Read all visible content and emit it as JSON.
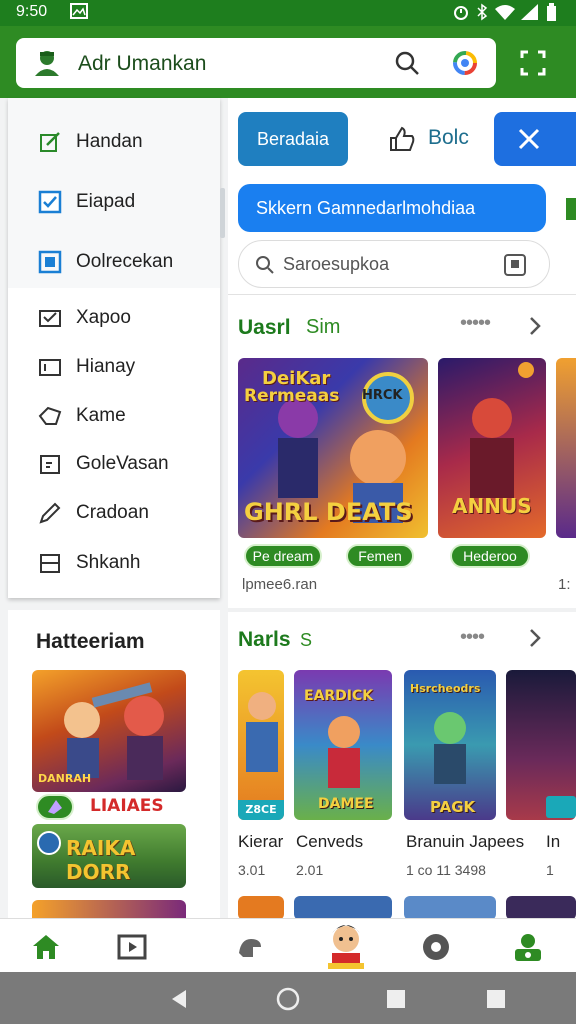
{
  "status_bar": {
    "time": "9:50"
  },
  "app_bar": {
    "title": "Adr Umankan"
  },
  "drawer": {
    "items": [
      {
        "label": "Handan",
        "icon": "edit-square-icon"
      },
      {
        "label": "Eiapad",
        "icon": "checkbox-icon"
      },
      {
        "label": "Oolrecekan",
        "icon": "square-icon"
      },
      {
        "label": "Xapoo",
        "icon": "mail-check-icon"
      },
      {
        "label": "Hianay",
        "icon": "window-icon"
      },
      {
        "label": "Kame",
        "icon": "tag-icon"
      },
      {
        "label": "GoleVasan",
        "icon": "calendar-icon"
      },
      {
        "label": "Cradoan",
        "icon": "pencil-icon"
      },
      {
        "label": "Shkanh",
        "icon": "minus-box-icon"
      }
    ]
  },
  "side_card": {
    "title": "Hatteeriam",
    "game1_caption": "LIAIAES",
    "game1_art": "DANRAH",
    "game2_art": "RAIKA DORR"
  },
  "main": {
    "chips": {
      "primary": "Beradaia",
      "secondary": "Bolc"
    },
    "promo_bar": "Skkern Gamnedarlmohdiaa",
    "search_placeholder": "Saroesupkoa",
    "section1": {
      "title": "Uasrl",
      "title_suffix": "Sim",
      "games": [
        {
          "art_title": "Rermeaas",
          "art_top": "DeiKar",
          "art_bottom": "GHRL DEATS",
          "art_badge": "HRCK",
          "tag": "Pe dream"
        },
        {
          "art_title": "",
          "art_top": "",
          "art_bottom": "",
          "art_badge": "",
          "tag": "Femen"
        },
        {
          "art_title": "",
          "art_top": "",
          "art_bottom": "ANNUS",
          "art_badge": "",
          "tag": "Hederoo"
        }
      ],
      "caption": "lpmee6.ran",
      "caption_right": "1:"
    },
    "section2": {
      "title": "Narls",
      "title_suffix": "S",
      "games": [
        {
          "name": "Kierar",
          "sub": "3.01",
          "art": "",
          "badge": "Z8CE"
        },
        {
          "name": "Cenveds",
          "sub": "2.01",
          "art": "DAMEE",
          "art_top": "EARDICK",
          "badge": ""
        },
        {
          "name": "Branuin Japees",
          "sub": "1 co 11 3498",
          "art": "PAGK",
          "art_top": "Hsrcheodrs",
          "badge": ""
        },
        {
          "name": "In",
          "sub": "1",
          "art": "",
          "badge": ""
        }
      ]
    }
  },
  "colors": {
    "brand": "#2e8b23",
    "accent_blue": "#1a7fd4",
    "link_blue": "#1e6fe0"
  }
}
